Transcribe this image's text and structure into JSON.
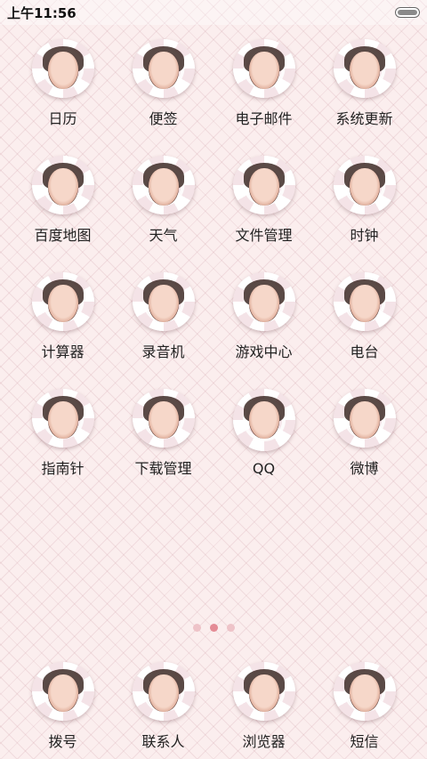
{
  "status_bar": {
    "time": "上午11:56"
  },
  "apps": [
    {
      "label": "日历",
      "icon": "calendar-icon"
    },
    {
      "label": "便签",
      "icon": "notes-icon"
    },
    {
      "label": "电子邮件",
      "icon": "email-icon"
    },
    {
      "label": "系统更新",
      "icon": "system-update-icon"
    },
    {
      "label": "百度地图",
      "icon": "baidu-map-icon"
    },
    {
      "label": "天气",
      "icon": "weather-icon"
    },
    {
      "label": "文件管理",
      "icon": "file-manager-icon"
    },
    {
      "label": "时钟",
      "icon": "clock-icon"
    },
    {
      "label": "计算器",
      "icon": "calculator-icon"
    },
    {
      "label": "录音机",
      "icon": "recorder-icon"
    },
    {
      "label": "游戏中心",
      "icon": "game-center-icon"
    },
    {
      "label": "电台",
      "icon": "radio-icon"
    },
    {
      "label": "指南针",
      "icon": "compass-icon"
    },
    {
      "label": "下载管理",
      "icon": "download-manager-icon"
    },
    {
      "label": "QQ",
      "icon": "qq-icon"
    },
    {
      "label": "微博",
      "icon": "weibo-icon"
    }
  ],
  "page_indicator": {
    "count": 3,
    "active": 2
  },
  "dock": [
    {
      "label": "拨号",
      "icon": "dialer-icon"
    },
    {
      "label": "联系人",
      "icon": "contacts-icon"
    },
    {
      "label": "浏览器",
      "icon": "browser-icon"
    },
    {
      "label": "短信",
      "icon": "sms-icon"
    }
  ]
}
